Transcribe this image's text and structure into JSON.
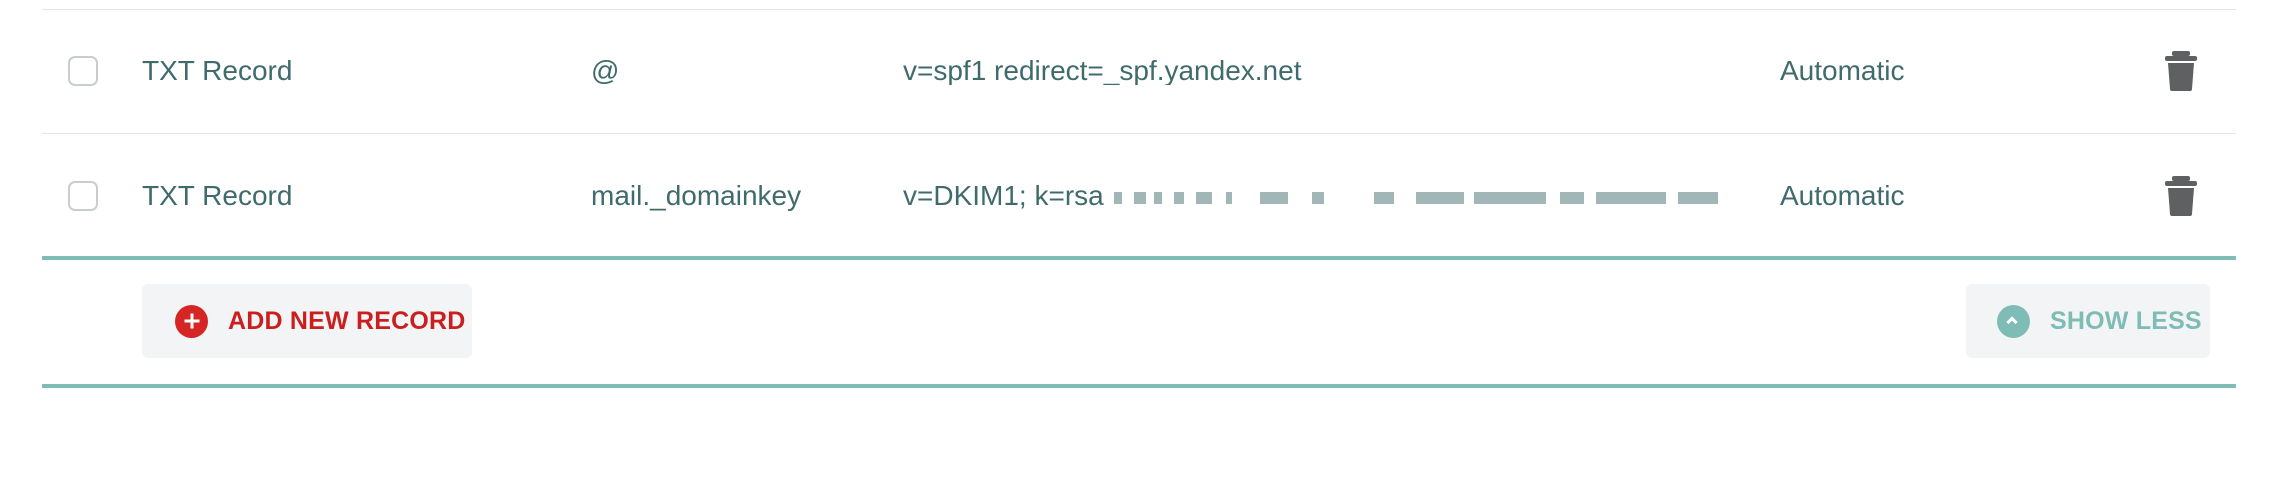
{
  "rows": [
    {
      "type": "TXT Record",
      "host": "@",
      "value": "v=spf1 redirect=_spf.yandex.net",
      "ttl": "Automatic"
    },
    {
      "type": "TXT Record",
      "host": "mail._domainkey",
      "value_prefix": "v=DKIM1; k=rsa",
      "ttl": "Automatic"
    }
  ],
  "buttons": {
    "add_new_record": "ADD NEW RECORD",
    "show_less": "SHOW LESS"
  },
  "colors": {
    "teal": "#7fbcb6",
    "text": "#3f6b6c",
    "red": "#d62525",
    "divider": "#e5e7e8",
    "trash": "#5f6061",
    "button_bg": "#f3f4f5"
  },
  "icons": {
    "checkbox": "checkbox-icon",
    "trash": "trash-icon",
    "add": "plus-circle-icon",
    "collapse": "chevron-up-circle-icon"
  }
}
